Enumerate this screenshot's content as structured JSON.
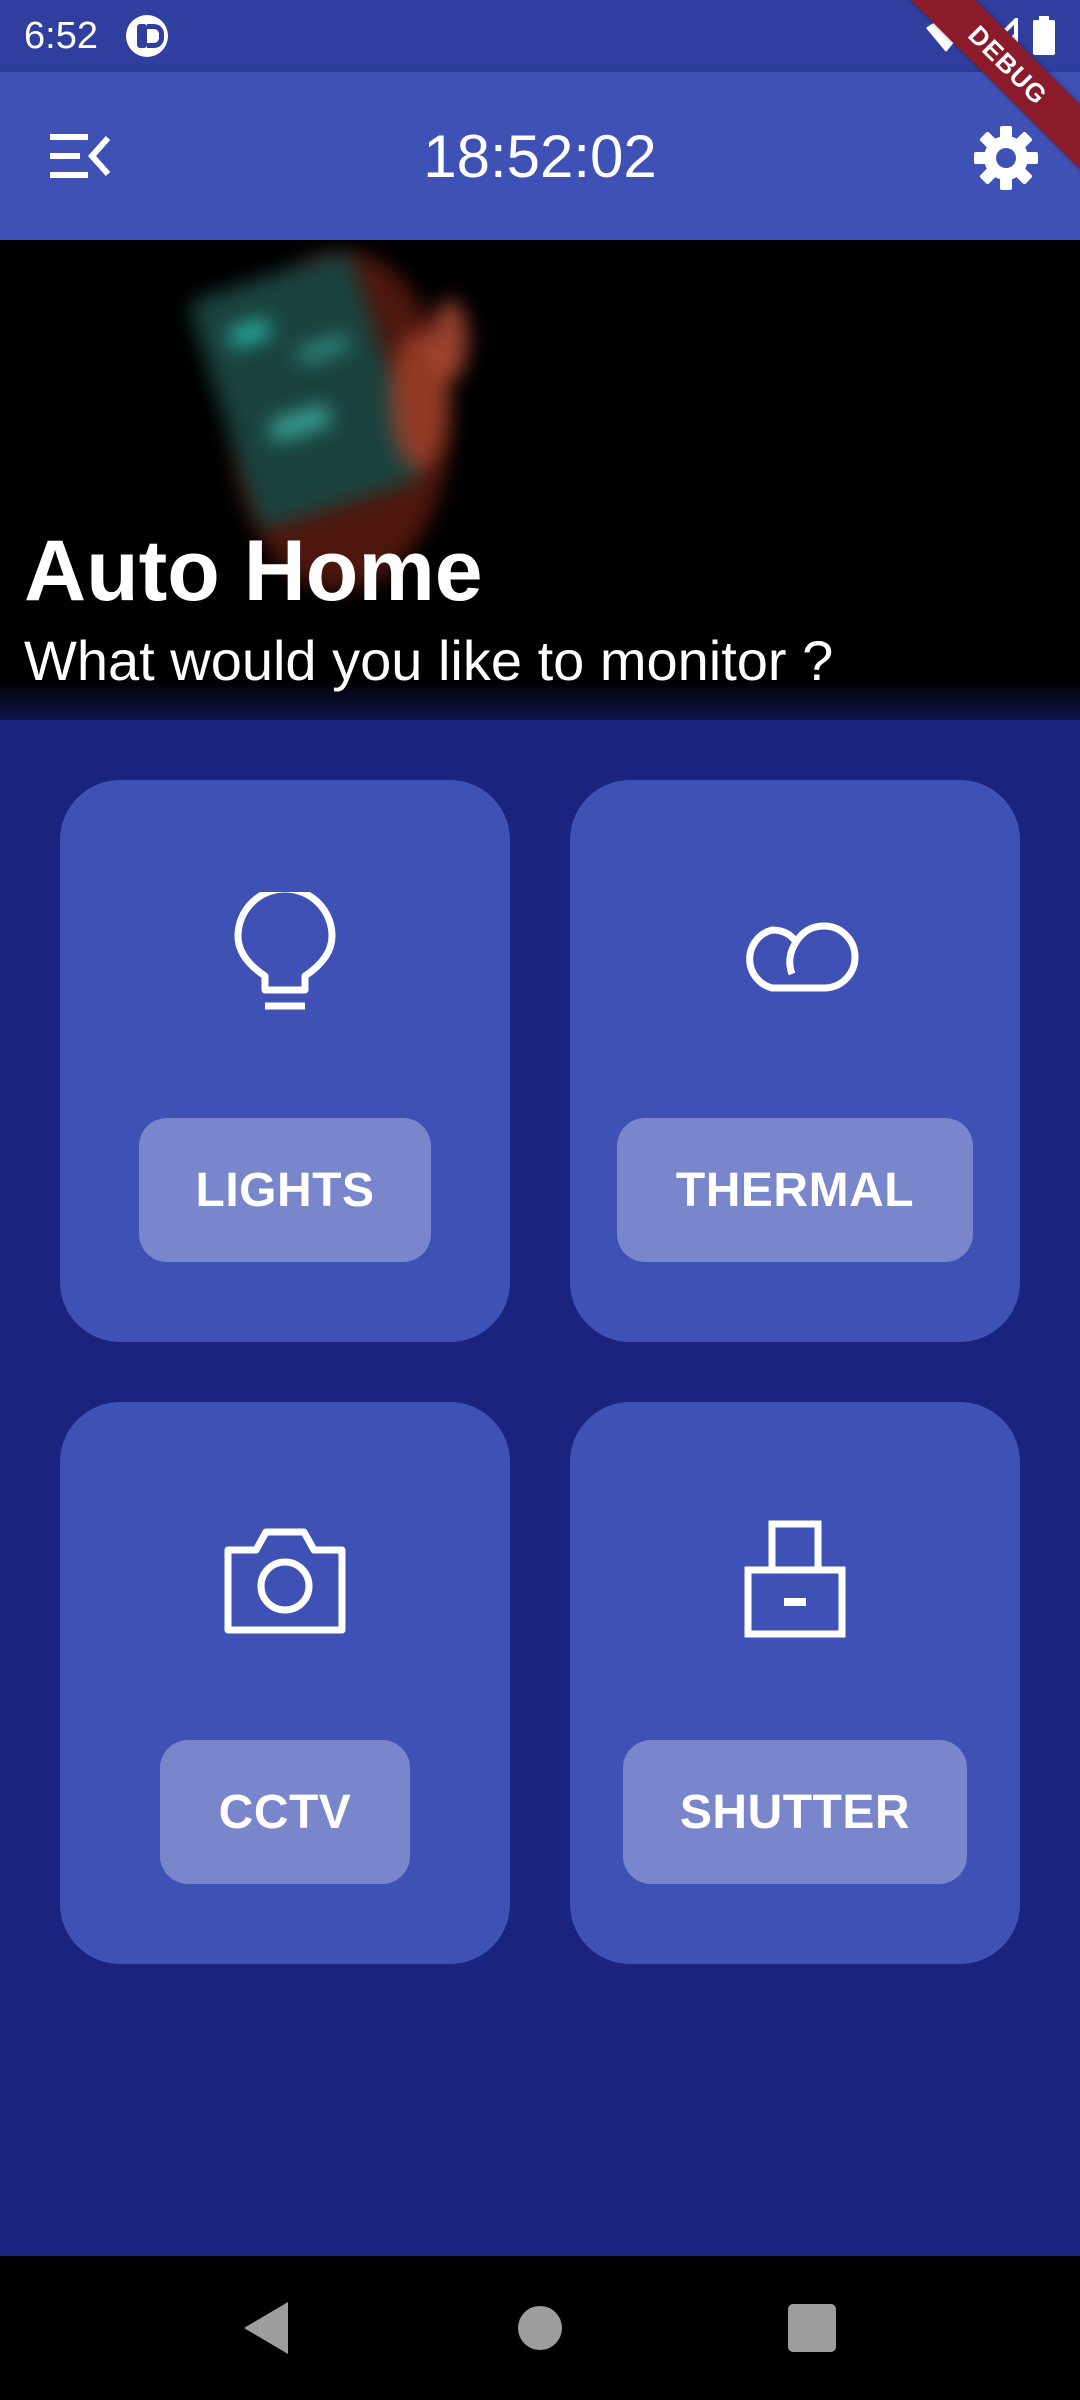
{
  "status_bar": {
    "time": "6:52",
    "icons": [
      "app-notification-icon",
      "wifi-icon",
      "signal-icon",
      "battery-icon"
    ]
  },
  "debug_banner": {
    "label": "DEBUG"
  },
  "app_bar": {
    "title": "18:52:02",
    "menu_icon": "menu-open-icon",
    "settings_icon": "gear-icon"
  },
  "hero": {
    "title": "Auto Home",
    "subtitle": "What would you like to monitor ?"
  },
  "cards": [
    {
      "label": "LIGHTS",
      "icon": "lightbulb-icon"
    },
    {
      "label": "THERMAL",
      "icon": "cloud-icon"
    },
    {
      "label": "CCTV",
      "icon": "camera-icon"
    },
    {
      "label": "SHUTTER",
      "icon": "lock-icon"
    }
  ],
  "nav_bar": {
    "buttons": [
      "back-icon",
      "home-icon",
      "recents-icon"
    ]
  },
  "colors": {
    "background": "#1a237e",
    "primary": "#3f51b5",
    "status_bar": "#303f9f",
    "button": "#7986cb",
    "debug_banner": "#8b1a2b"
  }
}
